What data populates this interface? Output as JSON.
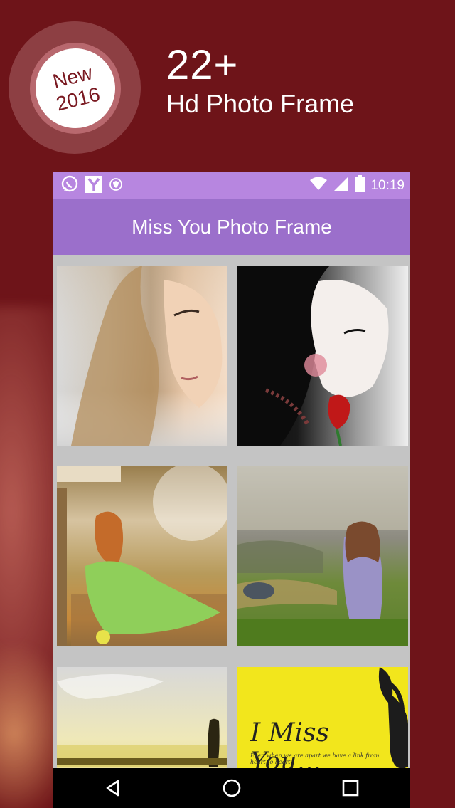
{
  "promo": {
    "badge_line1": "New",
    "badge_line2": "2016",
    "headline_number": "22+",
    "headline_sub": "Hd Photo Frame"
  },
  "status_bar": {
    "time": "10:19",
    "icons": [
      "whatsapp-icon",
      "y-app-icon",
      "shield-icon",
      "wifi-icon",
      "signal-icon",
      "battery-icon"
    ]
  },
  "app_bar": {
    "title": "Miss You Photo Frame"
  },
  "frames": [
    {
      "name": "frame-1",
      "caption": ""
    },
    {
      "name": "frame-2",
      "caption": ""
    },
    {
      "name": "frame-3",
      "caption": ""
    },
    {
      "name": "frame-4",
      "caption": ""
    },
    {
      "name": "frame-5",
      "caption": ""
    },
    {
      "name": "frame-6",
      "caption": "I Miss You...",
      "subcaption": "Even when we are apart we have a link from heart to heart."
    }
  ],
  "nav_bar": {
    "buttons": [
      "back-icon",
      "home-icon",
      "recents-icon"
    ]
  },
  "colors": {
    "background": "#6e1419",
    "status_bar": "#b786e0",
    "app_bar": "#9b6fcb",
    "grid_bg": "#c4c4c4"
  }
}
